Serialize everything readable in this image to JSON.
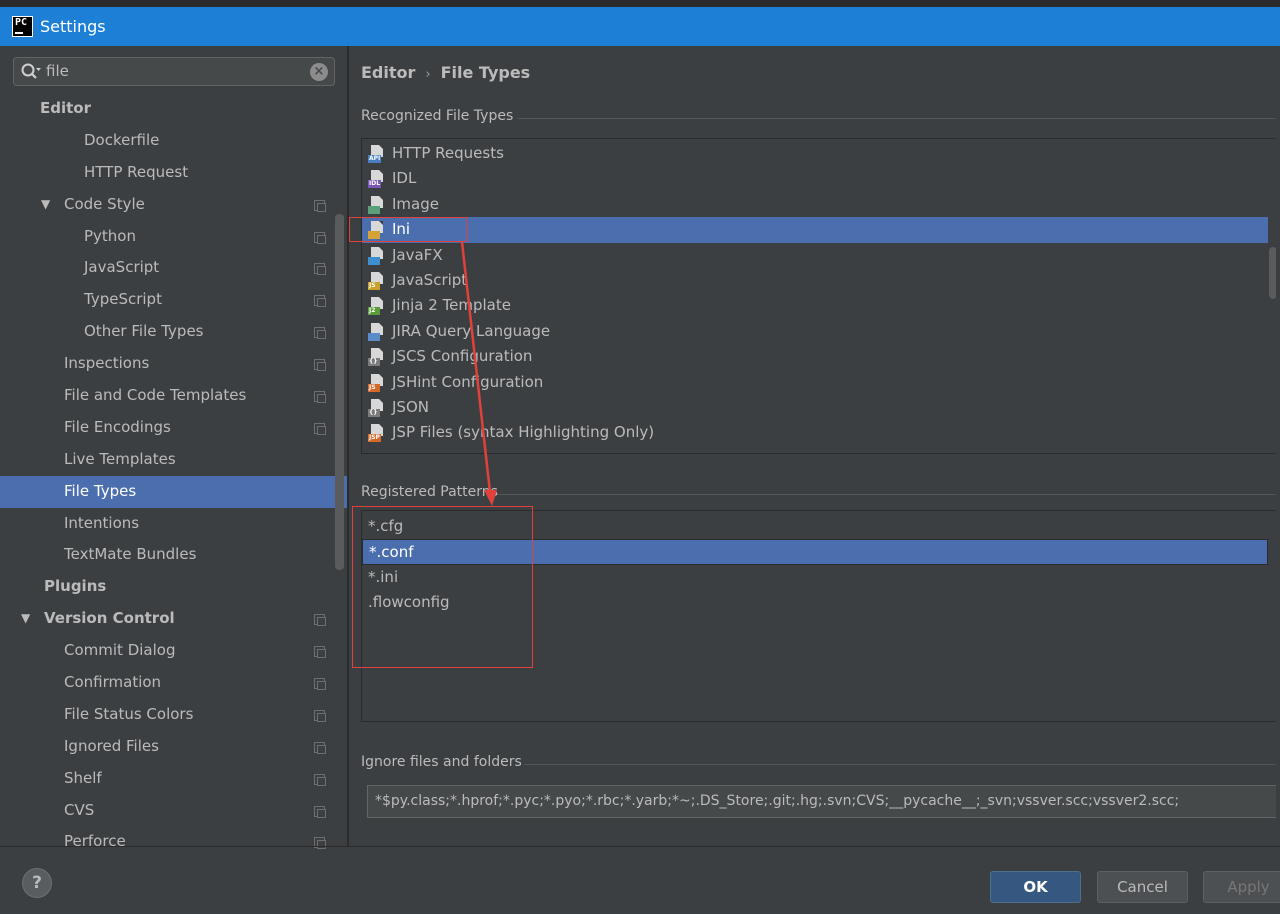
{
  "window": {
    "title": "Settings",
    "app_icon_text": "PC"
  },
  "search": {
    "value": "file"
  },
  "sidebar": {
    "items": [
      {
        "label": "Editor",
        "level": 0,
        "bold": true,
        "arrow": ""
      },
      {
        "label": "Dockerfile",
        "level": 2
      },
      {
        "label": "HTTP Request",
        "level": 2
      },
      {
        "label": "Code Style",
        "level": 1,
        "arrow": "▼",
        "copy": true
      },
      {
        "label": "Python",
        "level": 2,
        "copy": true
      },
      {
        "label": "JavaScript",
        "level": 2,
        "copy": true
      },
      {
        "label": "TypeScript",
        "level": 2,
        "copy": true
      },
      {
        "label": "Other File Types",
        "level": 2,
        "copy": true
      },
      {
        "label": "Inspections",
        "level": 1,
        "copy": true
      },
      {
        "label": "File and Code Templates",
        "level": 1,
        "copy": true
      },
      {
        "label": "File Encodings",
        "level": 1,
        "copy": true
      },
      {
        "label": "Live Templates",
        "level": 1
      },
      {
        "label": "File Types",
        "level": 1,
        "selected": true
      },
      {
        "label": "Intentions",
        "level": 1
      },
      {
        "label": "TextMate Bundles",
        "level": 1
      },
      {
        "label": "Plugins",
        "level": 0,
        "bold": true
      },
      {
        "label": "Version Control",
        "level": 0,
        "bold": true,
        "arrow": "▼",
        "copy": true
      },
      {
        "label": "Commit Dialog",
        "level": 1,
        "copy": true
      },
      {
        "label": "Confirmation",
        "level": 1,
        "copy": true
      },
      {
        "label": "File Status Colors",
        "level": 1,
        "copy": true
      },
      {
        "label": "Ignored Files",
        "level": 1,
        "copy": true
      },
      {
        "label": "Shelf",
        "level": 1,
        "copy": true
      },
      {
        "label": "CVS",
        "level": 1,
        "copy": true
      },
      {
        "label": "Perforce",
        "level": 1,
        "copy": true
      }
    ]
  },
  "breadcrumb": {
    "parent": "Editor",
    "separator": "›",
    "current": "File Types"
  },
  "recognized": {
    "title": "Recognized File Types",
    "items": [
      {
        "label": "HTTP Requests",
        "icon": "api-file-icon",
        "badge": "API",
        "badge_color": "#4a7ec0"
      },
      {
        "label": "IDL",
        "icon": "idl-file-icon",
        "badge": "IDL",
        "badge_color": "#7b57b8"
      },
      {
        "label": "Image",
        "icon": "image-file-icon",
        "badge": "",
        "badge_color": "#5aa07a"
      },
      {
        "label": "Ini",
        "icon": "ini-file-icon",
        "badge": "",
        "badge_color": "#d5a23a",
        "selected": true
      },
      {
        "label": "JavaFX",
        "icon": "javafx-file-icon",
        "badge": "",
        "badge_color": "#3f8fd0"
      },
      {
        "label": "JavaScript",
        "icon": "js-file-icon",
        "badge": "JS",
        "badge_color": "#c8a02a"
      },
      {
        "label": "Jinja 2 Template",
        "icon": "jinja-file-icon",
        "badge": "J2",
        "badge_color": "#5d9a3c"
      },
      {
        "label": "JIRA Query Language",
        "icon": "jira-file-icon",
        "badge": "",
        "badge_color": "#5b8cc8"
      },
      {
        "label": "JSCS Configuration",
        "icon": "jscs-file-icon",
        "badge": "{}",
        "badge_color": "#7c7c7c"
      },
      {
        "label": "JSHint Configuration",
        "icon": "jshint-file-icon",
        "badge": "JS",
        "badge_color": "#d46a2a"
      },
      {
        "label": "JSON",
        "icon": "json-file-icon",
        "badge": "{}",
        "badge_color": "#7c7c7c"
      },
      {
        "label": "JSP Files (syntax Highlighting Only)",
        "icon": "jsp-file-icon",
        "badge": "JSP",
        "badge_color": "#d46a2a"
      }
    ]
  },
  "patterns": {
    "title": "Registered Patterns",
    "items": [
      {
        "label": "*.cfg"
      },
      {
        "label": "*.conf",
        "selected": true
      },
      {
        "label": "*.ini"
      },
      {
        "label": ".flowconfig"
      }
    ]
  },
  "ignore": {
    "title": "Ignore files and folders",
    "value": "*$py.class;*.hprof;*.pyc;*.pyo;*.rbc;*.yarb;*~;.DS_Store;.git;.hg;.svn;CVS;__pycache__;_svn;vssver.scc;vssver2.scc;"
  },
  "buttons": {
    "help": "?",
    "ok": "OK",
    "cancel": "Cancel",
    "apply": "Apply"
  },
  "colors": {
    "accent": "#1e7fd6",
    "selection": "#4b6eaf",
    "annotation": "#e0413c"
  }
}
